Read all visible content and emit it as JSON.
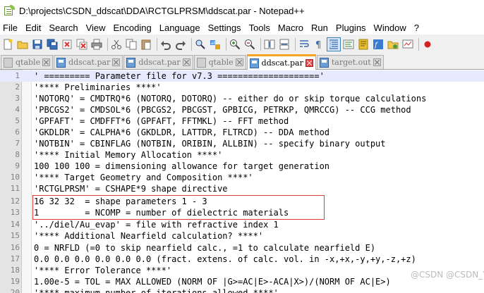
{
  "window": {
    "title": "D:\\projects\\CSDN_ddscat\\DDA\\RCTGLPRSM\\ddscat.par - Notepad++"
  },
  "menu": {
    "items": [
      "File",
      "Edit",
      "Search",
      "View",
      "Encoding",
      "Language",
      "Settings",
      "Tools",
      "Macro",
      "Run",
      "Plugins",
      "Window",
      "?"
    ]
  },
  "toolbar": {
    "icons": [
      "new-file-icon",
      "open-file-icon",
      "save-icon",
      "save-all-icon",
      "close-icon",
      "close-all-icon",
      "print-icon",
      "cut-icon",
      "copy-icon",
      "paste-icon",
      "undo-icon",
      "redo-icon",
      "find-icon",
      "replace-icon",
      "zoom-in-icon",
      "zoom-out-icon",
      "sync-vertical-icon",
      "sync-horizontal-icon",
      "word-wrap-icon",
      "show-all-chars-icon",
      "indent-guide-icon",
      "lang-icon",
      "doc-map-icon",
      "function-list-icon",
      "folder-workspace-icon",
      "monitoring-icon",
      "record-macro-icon"
    ]
  },
  "tabs": [
    {
      "label": "qtable",
      "icon": "gray",
      "active": false
    },
    {
      "label": "ddscat.par",
      "icon": "blue",
      "active": false
    },
    {
      "label": "ddscat.par",
      "icon": "blue",
      "active": false
    },
    {
      "label": "qtable",
      "icon": "gray",
      "active": false
    },
    {
      "label": "ddscat.par",
      "icon": "blue",
      "active": true
    },
    {
      "label": "target.out",
      "icon": "blue",
      "active": false
    }
  ],
  "editor": {
    "current_line": 1,
    "lines": [
      {
        "n": "1",
        "text": "' ========= Parameter file for v7.3 ===================='"
      },
      {
        "n": "2",
        "text": "'**** Preliminaries ****'"
      },
      {
        "n": "3",
        "text": "'NOTORQ' = CMDTRQ*6 (NOTORQ, DOTORQ) -- either do or skip torque calculations"
      },
      {
        "n": "4",
        "text": "'PBCGS2' = CMDSOL*6 (PBCGS2, PBCGST, GPBICG, PETRKP, QMRCCG) -- CCG method"
      },
      {
        "n": "5",
        "text": "'GPFAFT' = CMDFFT*6 (GPFAFT, FFTMKL) -- FFT method"
      },
      {
        "n": "6",
        "text": "'GKDLDR' = CALPHA*6 (GKDLDR, LATTDR, FLTRCD) -- DDA method"
      },
      {
        "n": "7",
        "text": "'NOTBIN' = CBINFLAG (NOTBIN, ORIBIN, ALLBIN) -- specify binary output"
      },
      {
        "n": "8",
        "text": "'**** Initial Memory Allocation ****'"
      },
      {
        "n": "9",
        "text": "100 100 100 = dimensioning allowance for target generation"
      },
      {
        "n": "10",
        "text": "'**** Target Geometry and Composition ****'"
      },
      {
        "n": "11",
        "text": "'RCTGLPRSM' = CSHAPE*9 shape directive"
      },
      {
        "n": "12",
        "text": "16 32 32  = shape parameters 1 - 3"
      },
      {
        "n": "13",
        "text": "1         = NCOMP = number of dielectric materials"
      },
      {
        "n": "14",
        "text": "'../diel/Au_evap' = file with refractive index 1"
      },
      {
        "n": "15",
        "text": "'**** Additional Nearfield calculation? ****'"
      },
      {
        "n": "16",
        "text": "0 = NRFLD (=0 to skip nearfield calc., =1 to calculate nearfield E)"
      },
      {
        "n": "17",
        "text": "0.0 0.0 0.0 0.0 0.0 0.0 (fract. extens. of calc. vol. in -x,+x,-y,+y,-z,+z)"
      },
      {
        "n": "18",
        "text": "'**** Error Tolerance ****'"
      },
      {
        "n": "19",
        "text": "1.00e-5 = TOL = MAX ALLOWED (NORM OF |G>=AC|E>-ACA|X>)/(NORM OF AC|E>)"
      },
      {
        "n": "20",
        "text": "'**** maximum number of iterations allowed ****'"
      }
    ]
  },
  "watermark": {
    "text": "@CSDN @CSDN_Yangf"
  }
}
